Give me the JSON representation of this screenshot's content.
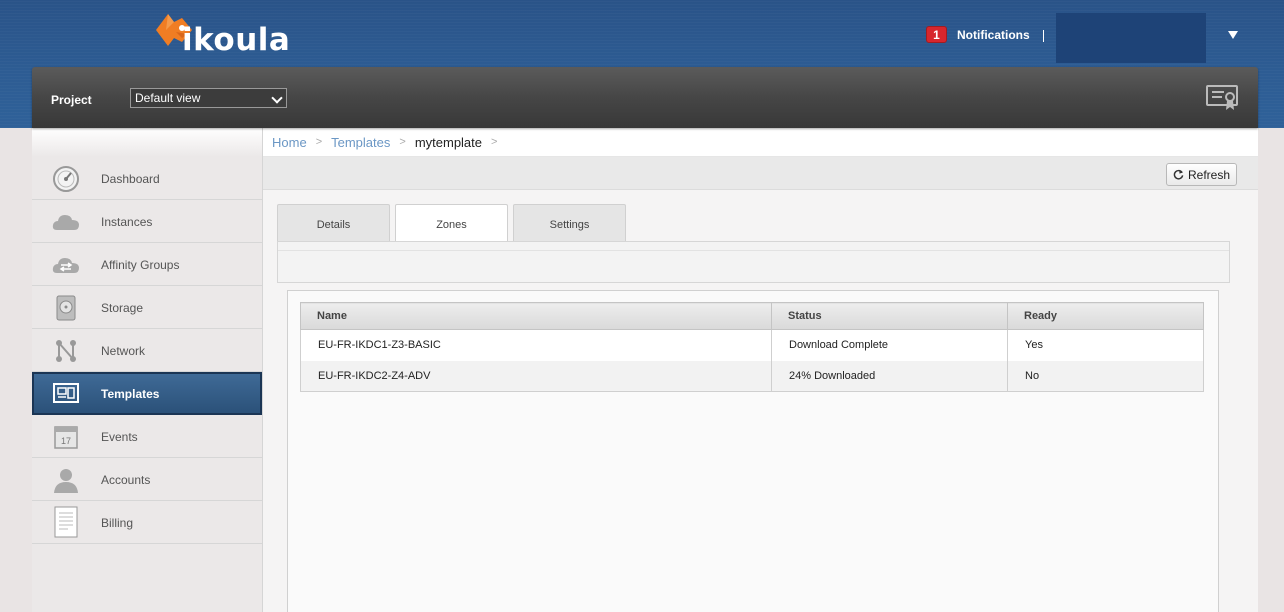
{
  "brand": {
    "logo_text": "ikoula",
    "logo_icon": "fish-logo-icon",
    "accent_color": "#f07d23"
  },
  "header": {
    "notifications_count": "1",
    "notifications_label": "Notifications",
    "separator": "|",
    "user_menu_icon": "caret-down-icon"
  },
  "project": {
    "label": "Project",
    "selected": "Default view",
    "right_icon": "certificate-icon"
  },
  "sidebar": {
    "items": [
      {
        "label": "Dashboard",
        "icon": "gauge-icon"
      },
      {
        "label": "Instances",
        "icon": "cloud-icon"
      },
      {
        "label": "Affinity Groups",
        "icon": "cloud-arrows-icon"
      },
      {
        "label": "Storage",
        "icon": "disk-icon"
      },
      {
        "label": "Network",
        "icon": "network-icon"
      },
      {
        "label": "Templates",
        "icon": "templates-icon",
        "active": true
      },
      {
        "label": "Events",
        "icon": "calendar-icon"
      },
      {
        "label": "Accounts",
        "icon": "user-icon"
      },
      {
        "label": "Billing",
        "icon": "document-icon"
      }
    ],
    "events_day": "17"
  },
  "breadcrumb": {
    "items": [
      "Home",
      "Templates",
      "mytemplate"
    ],
    "separator": ">"
  },
  "toolbar": {
    "refresh_label": "Refresh",
    "refresh_icon": "refresh-icon"
  },
  "tabs": [
    {
      "label": "Details"
    },
    {
      "label": "Zones",
      "active": true
    },
    {
      "label": "Settings"
    }
  ],
  "zones_table": {
    "headers": [
      "Name",
      "Status",
      "Ready"
    ],
    "rows": [
      [
        "EU-FR-IKDC1-Z3-BASIC",
        "Download Complete",
        "Yes"
      ],
      [
        "EU-FR-IKDC2-Z4-ADV",
        "24% Downloaded",
        "No"
      ]
    ]
  }
}
